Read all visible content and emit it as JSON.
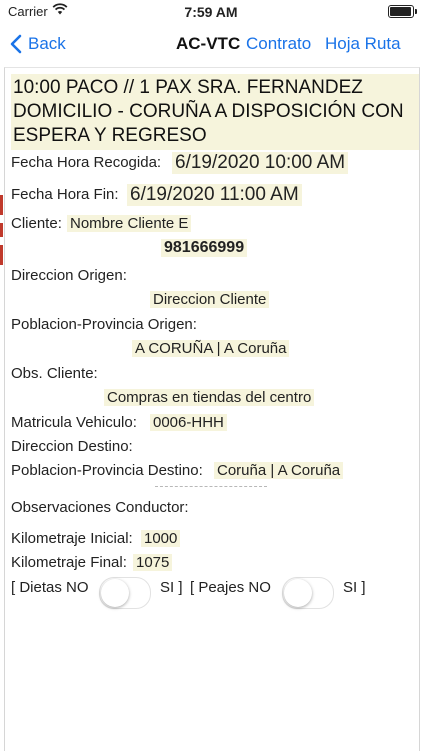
{
  "status": {
    "carrier": "Carrier",
    "time": "7:59 AM",
    "battery_level": 0.95
  },
  "nav": {
    "back_label": "Back",
    "title": "AC-VTC",
    "contrato_label": "Contrato",
    "hoja_label": "Hoja Ruta"
  },
  "service": {
    "summary": "10:00 PACO // 1 PAX SRA. FERNANDEZ DOMICILIO - CORUÑA A DISPOSICIÓN CON ESPERA Y REGRESO"
  },
  "fields": {
    "fecha_recogida_label": "Fecha Hora Recogida:",
    "fecha_recogida_value": "6/19/2020 10:00 AM",
    "fecha_fin_label": "Fecha Hora Fin:",
    "fecha_fin_value": "6/19/2020 11:00 AM",
    "cliente_label": "Cliente:",
    "cliente_value": "Nombre Cliente E",
    "telefono_value": "981666999",
    "direccion_origen_label": "Direccion Origen:",
    "direccion_origen_value": "Direccion Cliente",
    "poblacion_origen_label": "Poblacion-Provincia Origen:",
    "poblacion_origen_value": "A CORUÑA | A Coruña",
    "obs_cliente_label": "Obs. Cliente:",
    "obs_cliente_value": "Compras en tiendas del centro",
    "matricula_label": "Matricula Vehiculo:",
    "matricula_value": "0006-HHH",
    "direccion_destino_label": "Direccion Destino:",
    "poblacion_destino_label": "Poblacion-Provincia Destino:",
    "poblacion_destino_value": "Coruña | A Coruña",
    "obs_conductor_label": "Observaciones Conductor:",
    "km_inicial_label": "Kilometraje Inicial:",
    "km_inicial_value": "1000",
    "km_final_label": "Kilometraje Final:",
    "km_final_value": "1075"
  },
  "toggles": {
    "dietas_open": "[ Dietas NO",
    "dietas_close": "SI ]",
    "peajes_open": "[ Peajes NO",
    "peajes_close": "SI ]"
  }
}
